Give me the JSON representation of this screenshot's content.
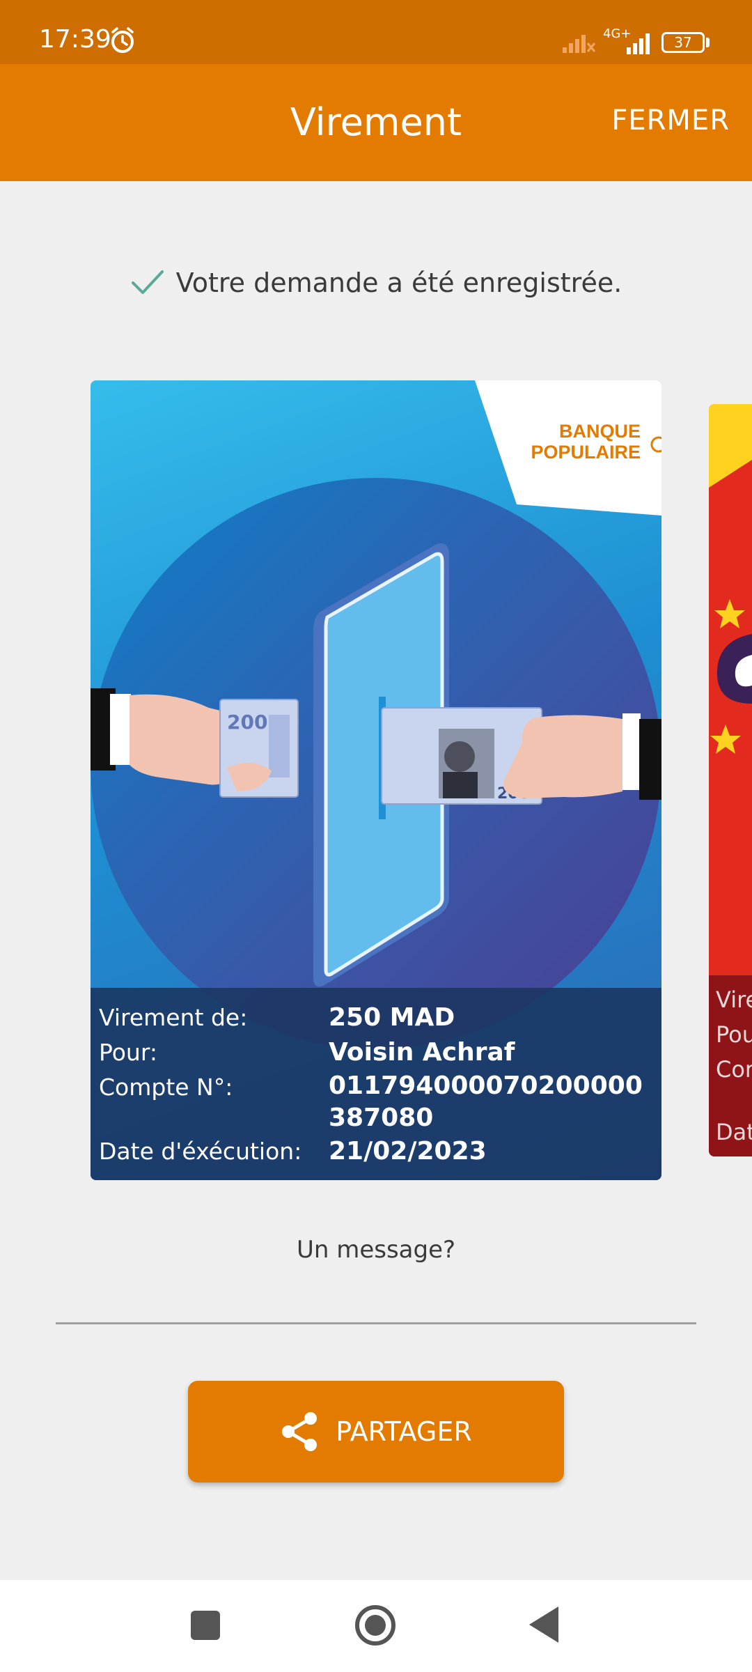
{
  "status_bar": {
    "time": "17:39",
    "network": "4G+",
    "battery": "37"
  },
  "app_bar": {
    "title": "Virement",
    "close_label": "FERMER"
  },
  "confirmation": {
    "text": "Votre demande a été enregistrée."
  },
  "card": {
    "brand_line1": "BANQUE",
    "brand_line2": "POPULAIRE",
    "note_left": "200",
    "note_right": "200",
    "rows": [
      {
        "label": "Virement de:",
        "value": "250 MAD"
      },
      {
        "label": "Pour:",
        "value": "Voisin Achraf"
      },
      {
        "label": "Compte N°:",
        "value": "011794000070200000387080"
      },
      {
        "label": "Date d'éxécution:",
        "value": "21/02/2023"
      }
    ]
  },
  "next_card": {
    "lines": [
      "Vire",
      "Pou",
      "Cor",
      "Dat"
    ]
  },
  "message": {
    "label": "Un message?",
    "value": ""
  },
  "share": {
    "label": "PARTAGER"
  },
  "colors": {
    "primary": "#e37b00",
    "status_bar": "#cf6e00",
    "check": "#5aa897",
    "card_info_bg": "#1a3560"
  }
}
